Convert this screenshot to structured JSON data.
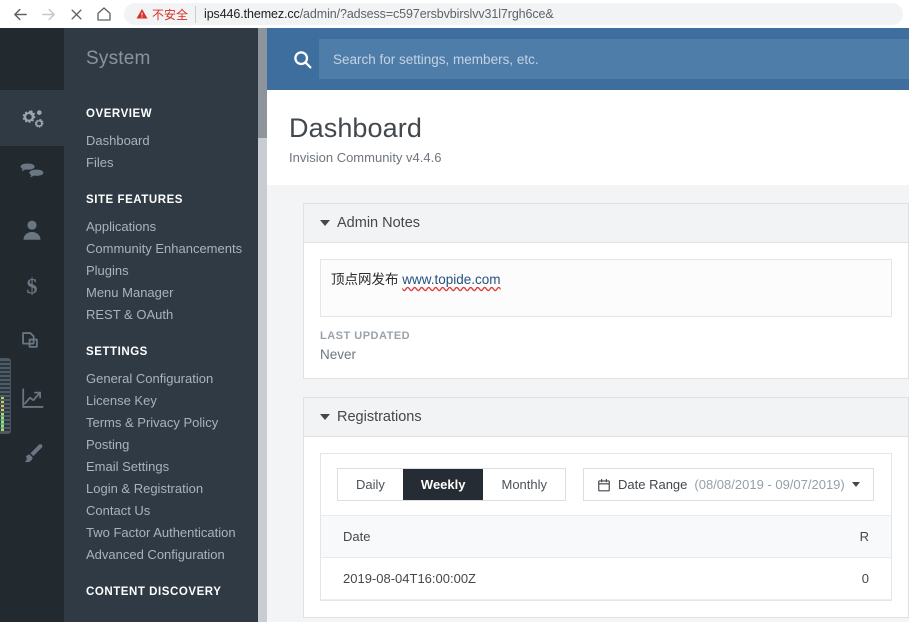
{
  "browser": {
    "nav": {
      "back": "back-arrow",
      "forward": "forward-arrow",
      "stop": "stop-x",
      "home": "home"
    },
    "security_label": "不安全",
    "url_host": "ips446.themez.cc",
    "url_path": "/admin/?adsess=c597ersbvbirslvv31l7rgh6ce&"
  },
  "rail": {
    "items": [
      {
        "name": "system",
        "icon": "gears-icon",
        "active": true
      },
      {
        "name": "community",
        "icon": "speech-bubbles-icon",
        "active": false
      },
      {
        "name": "members",
        "icon": "person-icon",
        "active": false
      },
      {
        "name": "commerce",
        "icon": "dollar-icon",
        "active": false
      },
      {
        "name": "pages",
        "icon": "pages-icon",
        "active": false
      },
      {
        "name": "stats",
        "icon": "chart-trend-icon",
        "active": false
      },
      {
        "name": "customization",
        "icon": "paintbrush-icon",
        "active": false
      }
    ]
  },
  "sidebar": {
    "title": "System",
    "groups": [
      {
        "heading": "OVERVIEW",
        "items": [
          "Dashboard",
          "Files"
        ]
      },
      {
        "heading": "SITE FEATURES",
        "items": [
          "Applications",
          "Community Enhancements",
          "Plugins",
          "Menu Manager",
          "REST & OAuth"
        ]
      },
      {
        "heading": "SETTINGS",
        "items": [
          "General Configuration",
          "License Key",
          "Terms & Privacy Policy",
          "Posting",
          "Email Settings",
          "Login & Registration",
          "Contact Us",
          "Two Factor Authentication",
          "Advanced Configuration"
        ]
      },
      {
        "heading": "CONTENT DISCOVERY",
        "items": []
      }
    ]
  },
  "search": {
    "placeholder": "Search for settings, members, etc.",
    "value": "",
    "icon": "search-icon"
  },
  "page": {
    "title": "Dashboard",
    "subtitle": "Invision Community v4.4.6"
  },
  "admin_notes": {
    "panel_title": "Admin Notes",
    "note_text": "顶点网发布 ",
    "note_link": "www.topide.com",
    "last_updated_label": "LAST UPDATED",
    "last_updated_value": "Never"
  },
  "registrations": {
    "panel_title": "Registrations",
    "tabs": [
      {
        "label": "Daily",
        "active": false
      },
      {
        "label": "Weekly",
        "active": true
      },
      {
        "label": "Monthly",
        "active": false
      }
    ],
    "date_range_label": "Date Range",
    "date_range_value": "(08/08/2019 - 09/07/2019)",
    "date_range_icon": "calendar-icon",
    "table": {
      "columns": [
        "Date",
        "R"
      ],
      "rows": [
        {
          "date": "2019-08-04T16:00:00Z",
          "count": "0"
        }
      ]
    }
  },
  "colors": {
    "rail_bg": "#22292f",
    "nav_bg": "#2f3a45",
    "search_bg": "#3d6e9e",
    "active_tab": "#262c33",
    "warning": "#d93025"
  }
}
